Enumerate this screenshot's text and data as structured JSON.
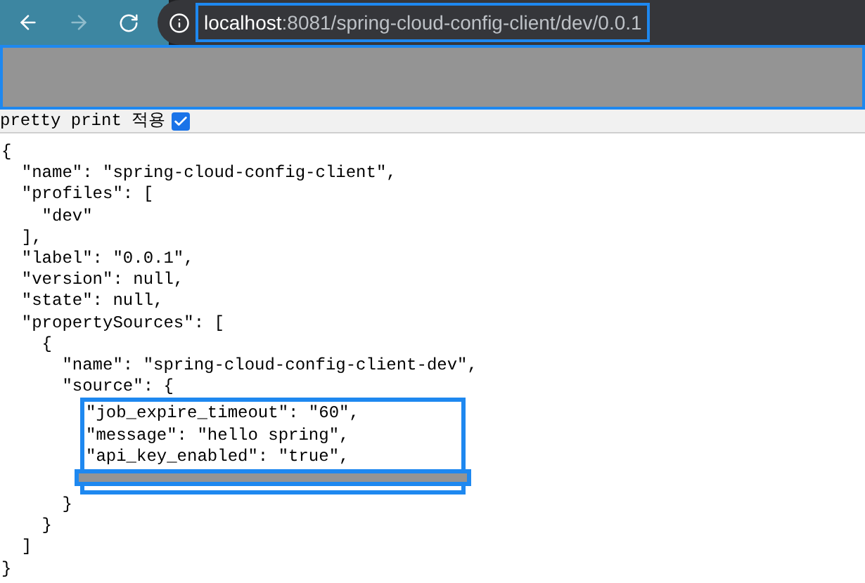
{
  "browser": {
    "url_host": "localhost",
    "url_rest": ":8081/spring-cloud-config-client/dev/0.0.1",
    "back_disabled": false,
    "forward_disabled": true
  },
  "pretty_print": {
    "label": "pretty print 적용",
    "checked": true
  },
  "json_lines": [
    "{",
    "  \"name\": \"spring-cloud-config-client\",",
    "  \"profiles\": [",
    "    \"dev\"",
    "  ],",
    "  \"label\": \"0.0.1\",",
    "  \"version\": null,",
    "  \"state\": null,",
    "  \"propertySources\": [",
    "    {",
    "      \"name\": \"spring-cloud-config-client-dev\",",
    "      \"source\": {"
  ],
  "highlighted_lines": [
    "\"job_expire_timeout\": \"60\",",
    "\"message\": \"hello spring\",",
    "\"api_key_enabled\": \"true\","
  ],
  "closing_lines": [
    "      }",
    "    }",
    "  ]",
    "}"
  ]
}
